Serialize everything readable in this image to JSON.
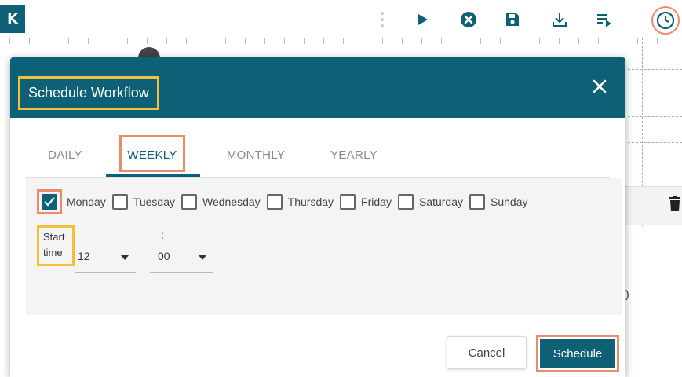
{
  "toolbar": {
    "collapse_glyph": "K",
    "icons": [
      "more-vertical-icon",
      "play-icon",
      "stop-icon",
      "save-icon",
      "download-icon",
      "list-icon",
      "clock-icon"
    ]
  },
  "canvas": {
    "partial_text": ")"
  },
  "modal": {
    "title": "Schedule Workflow",
    "tabs": [
      {
        "label": "DAILY",
        "active": false
      },
      {
        "label": "WEEKLY",
        "active": true
      },
      {
        "label": "MONTHLY",
        "active": false
      },
      {
        "label": "YEARLY",
        "active": false
      }
    ],
    "days": [
      {
        "label": "Monday",
        "checked": true
      },
      {
        "label": "Tuesday",
        "checked": false
      },
      {
        "label": "Wednesday",
        "checked": false
      },
      {
        "label": "Thursday",
        "checked": false
      },
      {
        "label": "Friday",
        "checked": false
      },
      {
        "label": "Saturday",
        "checked": false
      },
      {
        "label": "Sunday",
        "checked": false
      }
    ],
    "start_time": {
      "label_line1": "Start",
      "label_line2": "time",
      "separator": ":",
      "hour": "12",
      "minute": "00"
    },
    "buttons": {
      "cancel": "Cancel",
      "schedule": "Schedule"
    }
  },
  "colors": {
    "primary": "#0e6077",
    "highlight_orange": "#ec8a6c",
    "highlight_yellow": "#f0c23b"
  }
}
